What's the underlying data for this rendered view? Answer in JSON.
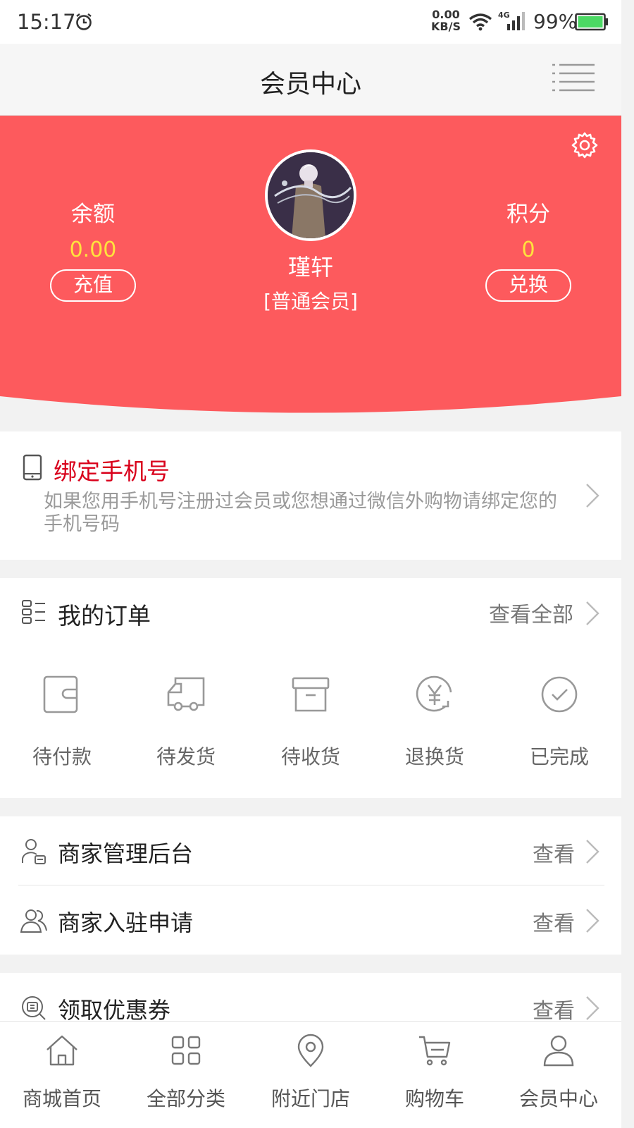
{
  "status_bar": {
    "time": "15:17",
    "net_speed_value": "0.00",
    "net_speed_unit": "KB/S",
    "network_type": "4G",
    "battery": "99%"
  },
  "header": {
    "title": "会员中心"
  },
  "profile": {
    "balance_label": "余额",
    "balance_value": "0.00",
    "recharge_button": "充值",
    "points_label": "积分",
    "points_value": "0",
    "exchange_button": "兑换",
    "username": "瑾轩",
    "member_level": "[普通会员]"
  },
  "bind_phone": {
    "title": "绑定手机号",
    "description": "如果您用手机号注册过会员或您想通过微信外购物请绑定您的手机号码"
  },
  "orders": {
    "title": "我的订单",
    "view_all": "查看全部",
    "items": [
      {
        "label": "待付款",
        "icon": "wallet-icon"
      },
      {
        "label": "待发货",
        "icon": "truck-icon"
      },
      {
        "label": "待收货",
        "icon": "box-icon"
      },
      {
        "label": "退换货",
        "icon": "refund-icon"
      },
      {
        "label": "已完成",
        "icon": "check-circle-icon"
      }
    ]
  },
  "merchant": {
    "admin_label": "商家管理后台",
    "admin_action": "查看",
    "join_label": "商家入驻申请",
    "join_action": "查看"
  },
  "coupon": {
    "label": "领取优惠券",
    "action": "查看"
  },
  "tab_bar": {
    "items": [
      {
        "label": "商城首页",
        "icon": "home-icon"
      },
      {
        "label": "全部分类",
        "icon": "grid-icon"
      },
      {
        "label": "附近门店",
        "icon": "location-icon"
      },
      {
        "label": "购物车",
        "icon": "cart-icon"
      },
      {
        "label": "会员中心",
        "icon": "user-icon"
      }
    ]
  },
  "colors": {
    "banner": "#fd5a5d",
    "accent_red": "#d9001b",
    "value_yellow": "#ffe23d"
  }
}
